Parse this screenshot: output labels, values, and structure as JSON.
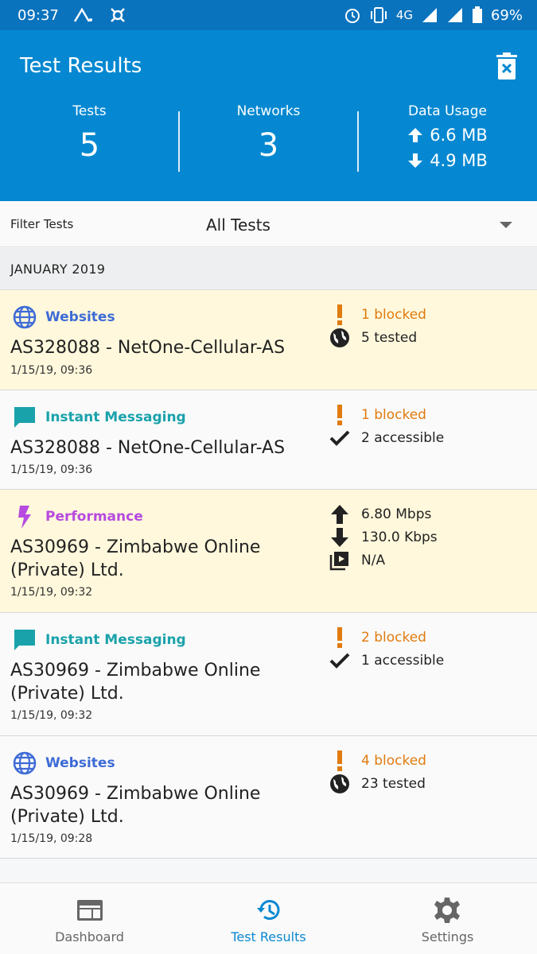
{
  "status_bar": {
    "time": "09:37",
    "network": "4G",
    "battery": "69%"
  },
  "header": {
    "title": "Test Results",
    "stats": {
      "tests_label": "Tests",
      "tests_value": "5",
      "networks_label": "Networks",
      "networks_value": "3",
      "usage_label": "Data Usage",
      "upload": "6.6 MB",
      "download": "4.9 MB"
    }
  },
  "filter": {
    "label": "Filter Tests",
    "value": "All Tests"
  },
  "section": {
    "title": "JANUARY 2019"
  },
  "items": [
    {
      "category": "Websites",
      "network": "AS328088 - NetOne-Cellular-AS",
      "time": "1/15/19, 09:36",
      "blocked": "1 blocked",
      "second": "5 tested"
    },
    {
      "category": "Instant Messaging",
      "network": "AS328088 - NetOne-Cellular-AS",
      "time": "1/15/19, 09:36",
      "blocked": "1 blocked",
      "second": "2 accessible"
    },
    {
      "category": "Performance",
      "network": "AS30969 - Zimbabwe Online (Private) Ltd.",
      "time": "1/15/19, 09:32",
      "upload": "6.80 Mbps",
      "download": "130.0 Kbps",
      "video": "N/A"
    },
    {
      "category": "Instant Messaging",
      "network": "AS30969 - Zimbabwe Online (Private) Ltd.",
      "time": "1/15/19, 09:32",
      "blocked": "2 blocked",
      "second": "1 accessible"
    },
    {
      "category": "Websites",
      "network": "AS30969 - Zimbabwe Online (Private) Ltd.",
      "time": "1/15/19, 09:28",
      "blocked": "4 blocked",
      "second": "23 tested"
    }
  ],
  "nav": {
    "dashboard": "Dashboard",
    "results": "Test Results",
    "settings": "Settings"
  },
  "colors": {
    "header": "#0588d1",
    "status_bar": "#0a73bd",
    "warn_row": "#fff8dc",
    "blocked": "#e07b10",
    "websites": "#3e6bd6",
    "messaging": "#1aa2ab",
    "performance": "#b74ae0"
  }
}
